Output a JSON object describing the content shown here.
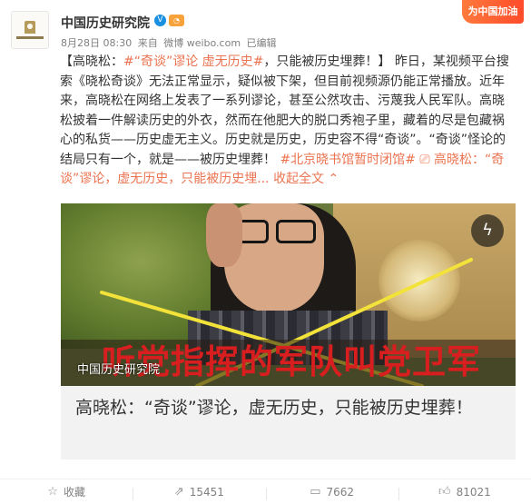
{
  "header": {
    "name": "中国历史研究院",
    "verified_icon": "verified-v-icon",
    "badge_icon": "vip-badge-icon",
    "date": "8月28日 08:30",
    "source_prefix": "来自",
    "source": "微博 weibo.com",
    "edited": "已编辑",
    "tag": "为中国加油"
  },
  "post": {
    "p1": "【高晓松：",
    "link1": "#“奇谈”谬论 虚无历史#",
    "p2": "，只能被历史埋葬！】 昨日，某视频平台搜索《晓松奇谈》无法正常显示，疑似被下架，但目前视频源仍能正常播放。近年来，高晓松在网络上发表了一系列谬论，甚至公然攻击、污蔑我人民军队。高晓松披着一件解读历史的外衣，然而在他肥大的脱口秀袍子里，藏着的尽是包藏祸心的私货——历史虚无主义。历史就是历史，历史容不得“奇谈”。“奇谈”怪论的结局只有一个，就是——被历史埋葬！",
    "link2": "#北京晓书馆暂时闭馆#",
    "link3": "高晓松：“奇谈”谬论，虚无历史，只能被历史埋...",
    "fold": "收起全文",
    "link_icon": "video-link-icon",
    "fold_icon": "chevron-up-icon"
  },
  "video": {
    "caption": "听党指挥的军队叫党卫军",
    "watermark": "中国历史研究院",
    "flash_icon": "lightning-icon",
    "title": "高晓松：“奇谈”谬论，虚无历史，只能被历史埋葬！"
  },
  "actions": [
    {
      "label": "收藏",
      "icon": "star-icon"
    },
    {
      "label": "15451",
      "icon": "repost-icon"
    },
    {
      "label": "7662",
      "icon": "comment-icon"
    },
    {
      "label": "81021",
      "icon": "thumbs-up-icon"
    }
  ],
  "colors": {
    "link": "#eb7350",
    "verified": "#1a90e0",
    "caption": "#d81e1e",
    "cross": "#f2e23a"
  }
}
